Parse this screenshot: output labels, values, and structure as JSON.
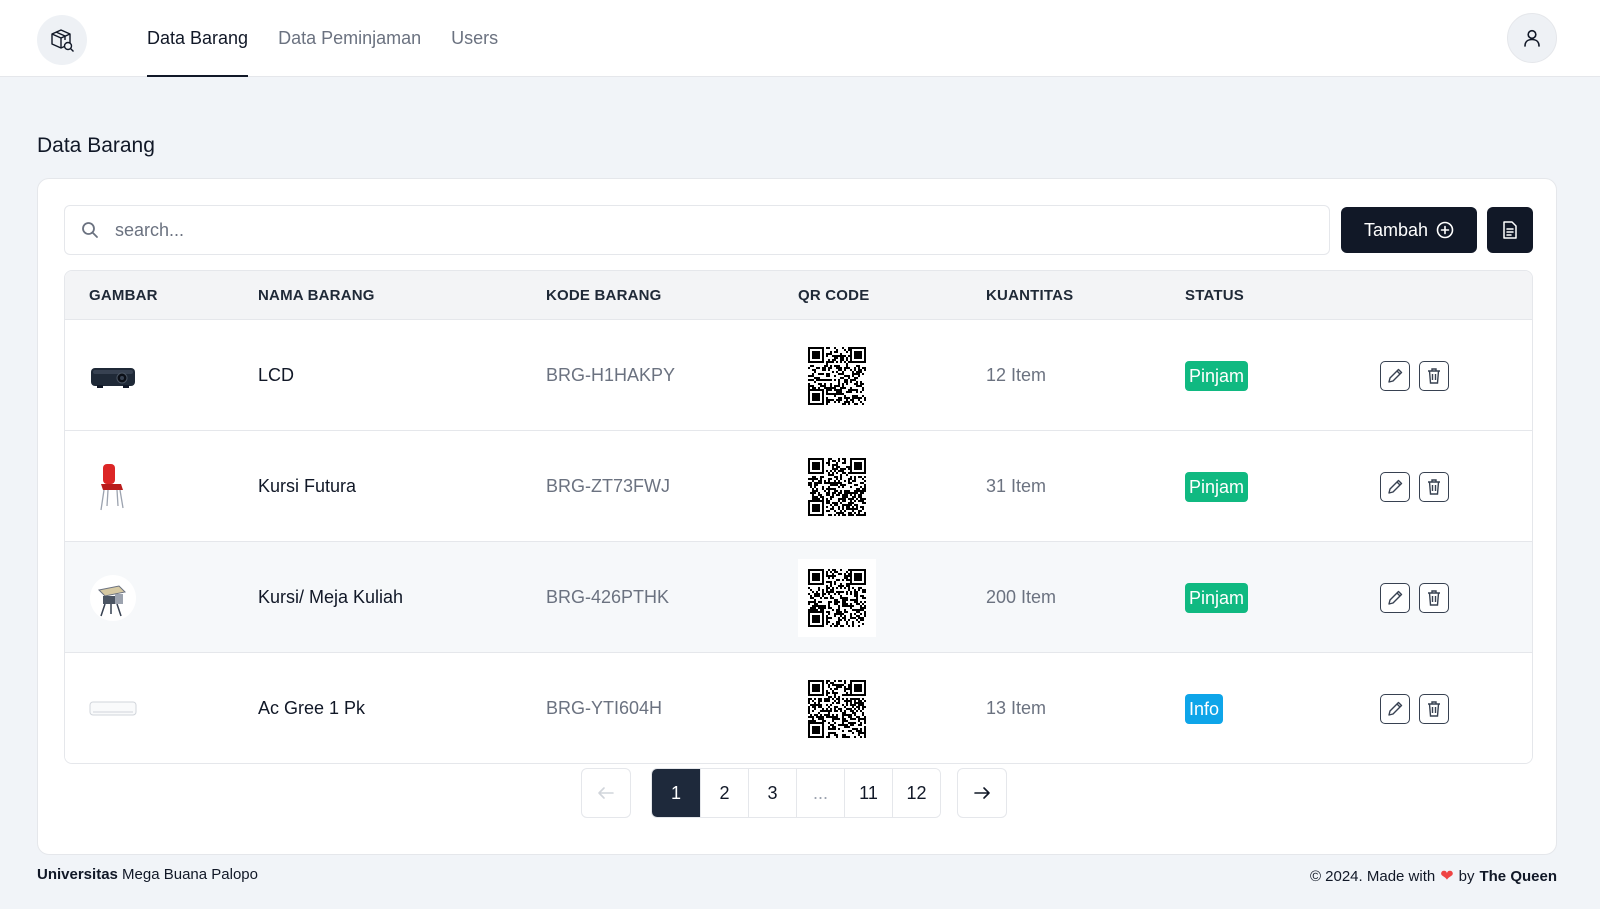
{
  "nav": {
    "items": [
      {
        "label": "Data Barang",
        "active": true
      },
      {
        "label": "Data Peminjaman",
        "active": false
      },
      {
        "label": "Users",
        "active": false
      }
    ]
  },
  "page": {
    "title": "Data Barang"
  },
  "toolbar": {
    "search_placeholder": "search...",
    "search_value": "",
    "add_label": "Tambah"
  },
  "table": {
    "headers": [
      "GAMBAR",
      "NAMA BARANG",
      "KODE BARANG",
      "QR CODE",
      "KUANTITAS",
      "STATUS"
    ],
    "rows": [
      {
        "image": "projector",
        "name": "LCD",
        "code": "BRG-H1HAKPY",
        "qty": "12 Item",
        "status": "Pinjam",
        "status_color": "#10b981"
      },
      {
        "image": "red-chair",
        "name": "Kursi Futura",
        "code": "BRG-ZT73FWJ",
        "qty": "31 Item",
        "status": "Pinjam",
        "status_color": "#10b981"
      },
      {
        "image": "desk-chair",
        "name": "Kursi/ Meja Kuliah",
        "code": "BRG-426PTHK",
        "qty": "200 Item",
        "status": "Pinjam",
        "status_color": "#10b981"
      },
      {
        "image": "air-conditioner",
        "name": "Ac Gree 1 Pk",
        "code": "BRG-YTI604H",
        "qty": "13 Item",
        "status": "Info",
        "status_color": "#0ea5e9"
      }
    ]
  },
  "pagination": {
    "prev_icon": "arrow-left-icon",
    "next_icon": "arrow-right-icon",
    "pages": [
      "1",
      "2",
      "3",
      "...",
      "11",
      "12"
    ],
    "current": "1"
  },
  "footer": {
    "left_bold": "Universitas",
    "left_rest": "Mega Buana Palopo",
    "right_prefix": "© 2024. Made with",
    "right_by": "by",
    "right_author": "The Queen"
  },
  "colors": {
    "primary": "#111827",
    "badge_pinjam": "#10b981",
    "badge_info": "#0ea5e9",
    "background": "#f1f4f8"
  }
}
